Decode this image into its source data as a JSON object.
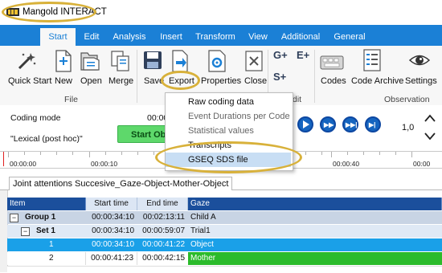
{
  "window": {
    "title": "Mangold INTERACT"
  },
  "tabs": [
    "Start",
    "Edit",
    "Analysis",
    "Insert",
    "Transform",
    "View",
    "Additional",
    "General"
  ],
  "ribbon": {
    "file_buttons": [
      "Quick Start",
      "New",
      "Open",
      "Merge",
      "Save",
      "Export",
      "Properties",
      "Close"
    ],
    "file_group_label": "File",
    "observation_buttons": [
      "Codes",
      "Code Archive",
      "Settings"
    ],
    "observation_group_label": "Observation",
    "edit_group_label_partial": "dit",
    "code_icons": [
      "G+",
      "E+",
      "S+"
    ]
  },
  "coding": {
    "mode_label": "Coding mode",
    "mode_value": "\"Lexical (post hoc)\"",
    "time_partial": "00:00",
    "start_button": "Start Obs",
    "speed": "1,0"
  },
  "timeline": {
    "ticks": [
      "00:00:00",
      "00:00:10",
      "00:00:40",
      "00:00"
    ]
  },
  "document_tab": "Joint attentions Succesive_Gaze-Object-Mother-Object",
  "grid": {
    "headers": [
      "Item",
      "Start time",
      "End time",
      "Gaze"
    ],
    "rows": [
      {
        "item": "Group  1",
        "start": "00:00:34:10",
        "end": "00:02:13:11",
        "gaze": "Child A",
        "toggle": "−"
      },
      {
        "item": "Set  1",
        "start": "00:00:34:10",
        "end": "00:00:59:07",
        "gaze": "Trial1",
        "toggle": "−"
      },
      {
        "item": "1",
        "start": "00:00:34:10",
        "end": "00:00:41:22",
        "gaze": "Object"
      },
      {
        "item": "2",
        "start": "00:00:41:23",
        "end": "00:00:42:15",
        "gaze": "Mother"
      }
    ]
  },
  "export_menu": {
    "items": [
      "Raw coding data",
      "Event Durations per Code",
      "Statistical values",
      "Transcripts",
      "GSEQ SDS file"
    ],
    "disabled": [
      false,
      true,
      true,
      false,
      false
    ],
    "highlighted_index": 4
  },
  "colors": {
    "accent": "#1b80d6",
    "header": "#1b4f9c",
    "selected_row": "#1aa0e8",
    "gaze_object": "#1aa0e8",
    "gaze_mother": "#2bbb2b",
    "start_button": "#5ed86b",
    "highlight_oval": "#d8b13a"
  }
}
